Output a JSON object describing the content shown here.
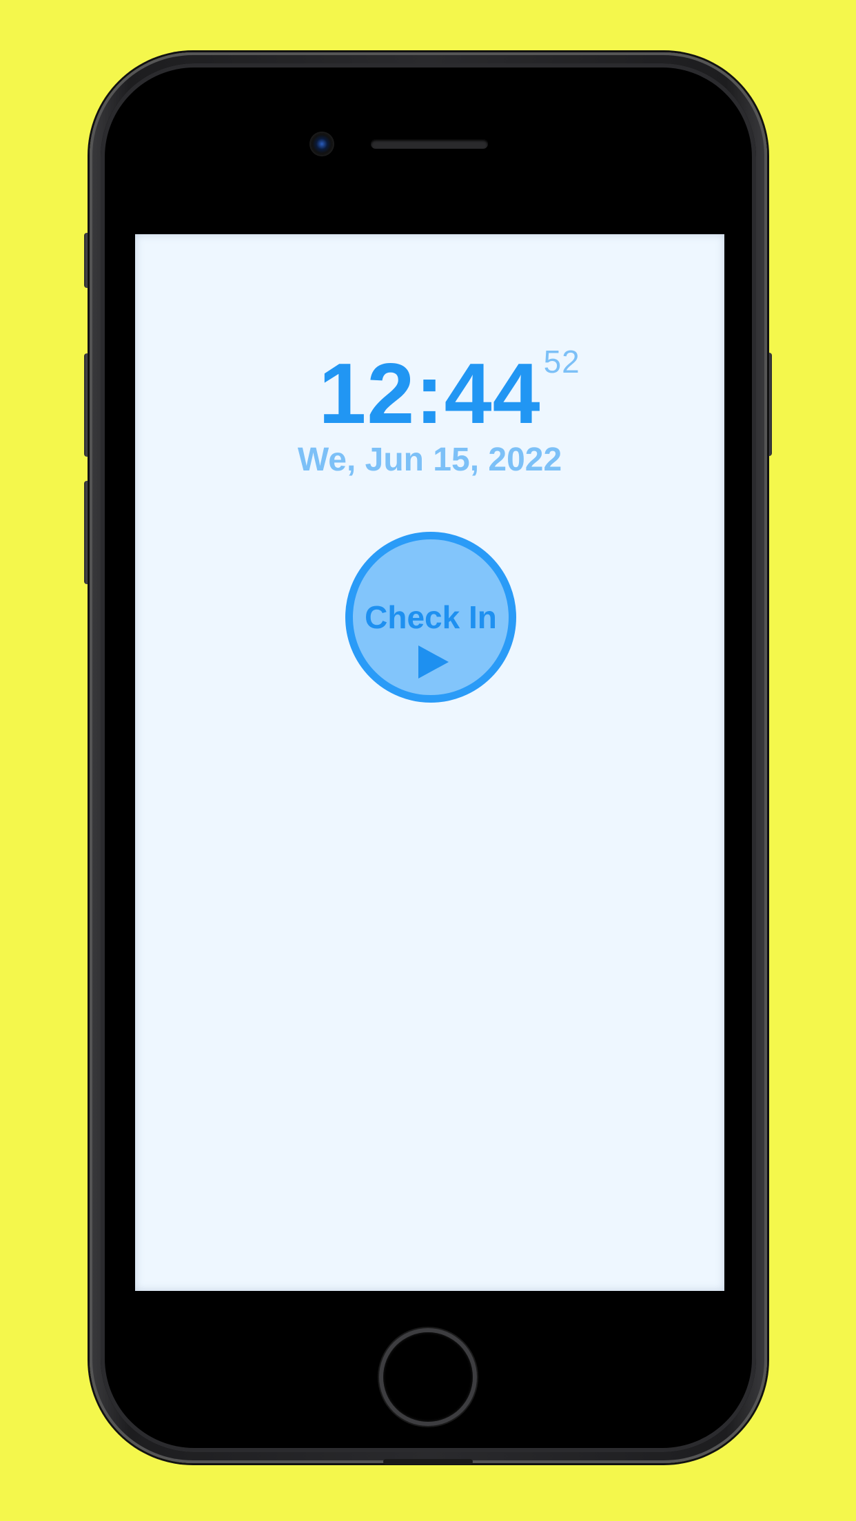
{
  "clock": {
    "hours_minutes": "12:44",
    "seconds": "52",
    "date": "We, Jun 15, 2022"
  },
  "checkin_button": {
    "label": "Check In",
    "icon": "play-icon"
  },
  "colors": {
    "background": "#f4f74c",
    "screen_bg": "#eef7ff",
    "accent": "#2196f3",
    "accent_light": "#7cc0f7",
    "button_fill": "#82c5fb"
  }
}
